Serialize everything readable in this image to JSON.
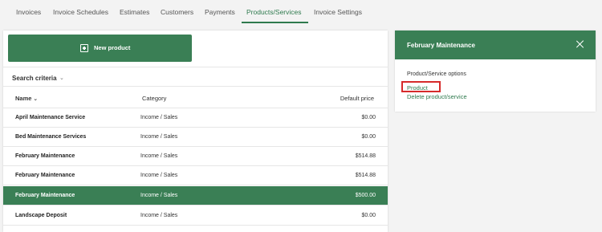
{
  "tabs": [
    {
      "label": "Invoices"
    },
    {
      "label": "Invoice Schedules"
    },
    {
      "label": "Estimates"
    },
    {
      "label": "Customers"
    },
    {
      "label": "Payments"
    },
    {
      "label": "Products/Services"
    },
    {
      "label": "Invoice Settings"
    }
  ],
  "active_tab": "Products/Services",
  "toolbar": {
    "new_label": "New product"
  },
  "search": {
    "label": "Search criteria"
  },
  "table": {
    "headers": {
      "name": "Name",
      "category": "Category",
      "price": "Default price"
    },
    "rows": [
      {
        "name": "April Maintenance Service",
        "category": "Income / Sales",
        "price": "$0.00"
      },
      {
        "name": "Bed Maintenance Services",
        "category": "Income / Sales",
        "price": "$0.00"
      },
      {
        "name": "February Maintenance",
        "category": "Income / Sales",
        "price": "$514.88"
      },
      {
        "name": "February Maintenance",
        "category": "Income / Sales",
        "price": "$514.88"
      },
      {
        "name": "February Maintenance",
        "category": "Income / Sales",
        "price": "$500.00"
      },
      {
        "name": "Landscape Deposit",
        "category": "Income / Sales",
        "price": "$0.00"
      }
    ],
    "selected_row": 4
  },
  "detail": {
    "title": "February Maintenance",
    "options_label": "Product/Service options",
    "product_link": "Product",
    "delete_link": "Delete product/service"
  },
  "colors": {
    "accent": "#3a7f55",
    "highlight": "#d62b2b"
  },
  "icons": {
    "new": "plus-square-icon",
    "close": "close-icon",
    "sort": "chevron-down-icon",
    "search": "caret-down-icon"
  }
}
